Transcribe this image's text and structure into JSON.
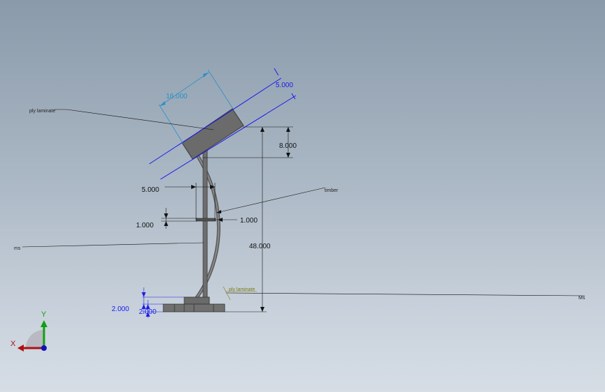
{
  "dimensions": {
    "d_16": "16.000",
    "d_5_top": "5.000",
    "d_8": "8.000",
    "d_5_mid": "5.000",
    "d_1_left": "1.000",
    "d_1_right": "1.000",
    "d_48": "48.000",
    "d_2_left": "2.000",
    "d_2_right": "2.000"
  },
  "notes": {
    "ply_laminate": "ply laminate",
    "timber": "timber",
    "ms_left": "ms",
    "ms_right": "Ms",
    "base_note": "ply laminate"
  },
  "triad": {
    "x_label": "X",
    "y_label": "Y"
  },
  "colors": {
    "dim_black": "#111111",
    "dim_blue": "#1a1aee",
    "dim_cyan": "#2a8fc8",
    "note_olive": "#7a7a10",
    "part_gray": "#6a6a6a",
    "x_axis": "#b01010",
    "y_axis": "#10a010",
    "z_axis": "#1010c0"
  }
}
